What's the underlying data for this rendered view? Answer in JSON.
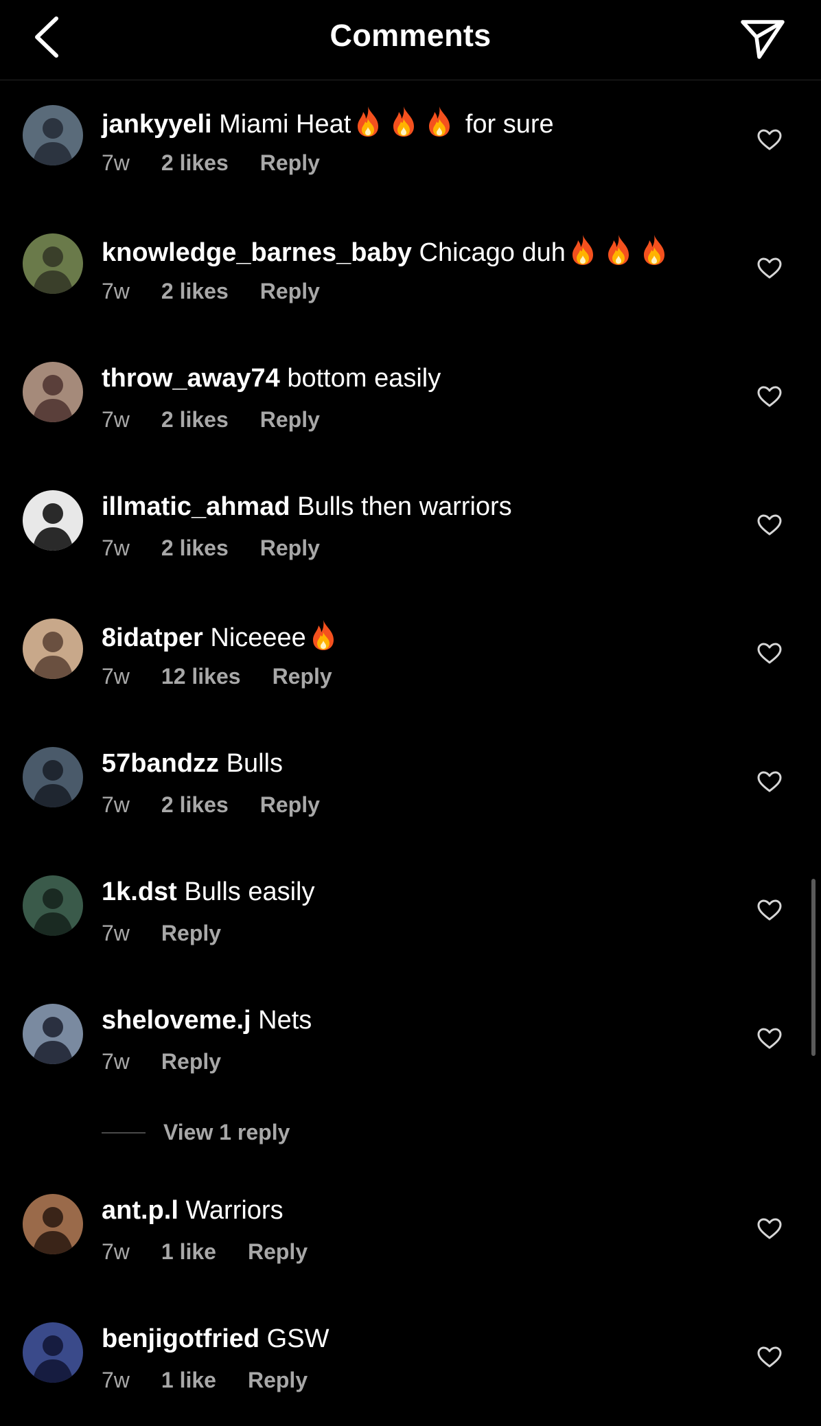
{
  "header": {
    "title": "Comments",
    "back_icon": "chevron-left-icon",
    "share_icon": "paper-plane-icon"
  },
  "colors": {
    "background": "#000000",
    "text": "#ffffff",
    "secondary_text": "#a8a8a8",
    "divider": "#262626"
  },
  "comments": [
    {
      "username": "jankyyeli",
      "text": "Miami Heat",
      "emoji_after": 3,
      "suffix": " for sure",
      "time": "7w",
      "likes": "2 likes",
      "reply": "Reply"
    },
    {
      "username": "knowledge_barnes_baby",
      "text": "Chicago duh",
      "emoji_after": 3,
      "suffix": "",
      "time": "7w",
      "likes": "2 likes",
      "reply": "Reply"
    },
    {
      "username": "throw_away74",
      "text": "bottom easily",
      "emoji_after": 0,
      "suffix": "",
      "time": "7w",
      "likes": "2 likes",
      "reply": "Reply"
    },
    {
      "username": "illmatic_ahmad",
      "text": "Bulls then warriors",
      "emoji_after": 0,
      "suffix": "",
      "time": "7w",
      "likes": "2 likes",
      "reply": "Reply"
    },
    {
      "username": "8idatper",
      "text": "Niceeee",
      "emoji_after": 1,
      "suffix": "",
      "time": "7w",
      "likes": "12 likes",
      "reply": "Reply"
    },
    {
      "username": "57bandzz",
      "text": "Bulls",
      "emoji_after": 0,
      "suffix": "",
      "time": "7w",
      "likes": "2 likes",
      "reply": "Reply"
    },
    {
      "username": "1k.dst",
      "text": "Bulls easily",
      "emoji_after": 0,
      "suffix": "",
      "time": "7w",
      "likes": "",
      "reply": "Reply"
    },
    {
      "username": "sheloveme.j",
      "text": "Nets",
      "emoji_after": 0,
      "suffix": "",
      "time": "7w",
      "likes": "",
      "reply": "Reply",
      "view_replies": "View 1 reply"
    },
    {
      "username": "ant.p.l",
      "text": "Warriors",
      "emoji_after": 0,
      "suffix": "",
      "time": "7w",
      "likes": "1 like",
      "reply": "Reply"
    },
    {
      "username": "benjigotfried",
      "text": "GSW",
      "emoji_after": 0,
      "suffix": "",
      "time": "7w",
      "likes": "1 like",
      "reply": "Reply"
    }
  ],
  "emoji": "fire-emoji",
  "like_icon": "heart-outline-icon"
}
